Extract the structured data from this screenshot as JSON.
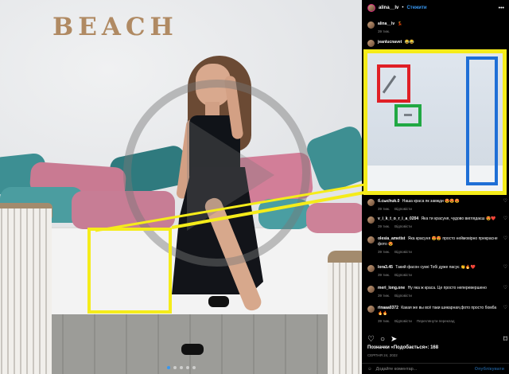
{
  "photo": {
    "sign_text": "BEACH",
    "slide_count": 5,
    "active_slide": 1
  },
  "post_header": {
    "username": "alina__lv",
    "separator": "•",
    "follow_label": "Стежити",
    "more_icon": "more-dots-icon"
  },
  "caption": {
    "username": "alina__lv",
    "text": "💃",
    "time": "39 тиж."
  },
  "comments": [
    {
      "username": "jeanlucnavet",
      "text": "😂😂",
      "time": "",
      "actions": []
    },
    {
      "username": "б.сысhuk.0",
      "text": "Наша краса як завжди 😍😍😍",
      "time": "39 тиж.",
      "actions": [
        "Відповісти"
      ]
    },
    {
      "username": "v_i_k_t_o_r_i_a_0204",
      "text": "Яка ти красуня, чудово виглядаєш 😍❤️",
      "time": "39 тиж.",
      "actions": [
        "Відповісти"
      ]
    },
    {
      "username": "olesia_ametist",
      "text": "Яка красуня 😍😍 просто неймовірно прекрасне фото 😍",
      "time": "39 тиж.",
      "actions": [
        "Відповісти"
      ]
    },
    {
      "username": "lora3.45",
      "text": "Такий фасон сукні Тобі дуже пасує 👏🔥❤️",
      "time": "39 тиж.",
      "actions": [
        "Відповісти"
      ]
    },
    {
      "username": "meri_long.one",
      "text": "Ну яка ж краса. Це просто неперевершено",
      "time": "39 тиж.",
      "actions": [
        "Відповісти"
      ]
    },
    {
      "username": "rinaaa0372",
      "text": "Какая же вы всё таки шикарная,фото просто бомба🔥🔥",
      "time": "39 тиж.",
      "actions": [
        "Відповісти",
        "Переглянути переклад"
      ]
    }
  ],
  "actions_bar": {
    "like_icon": "heart-icon",
    "comment_icon": "comment-icon",
    "share_icon": "send-icon",
    "save_icon": "bookmark-icon"
  },
  "likes_text": "Позначки «Подобається»: 168",
  "post_date": "СЕРПНЯ 24, 2022",
  "add_comment": {
    "placeholder": "Додайте коментар...",
    "publish_label": "Опублікувати",
    "emoji_icon": "smiley-icon"
  },
  "annotations": {
    "yellow": "#f5ec1a",
    "red": "#e01f26",
    "green": "#21a843",
    "blue": "#1f6fd6"
  }
}
